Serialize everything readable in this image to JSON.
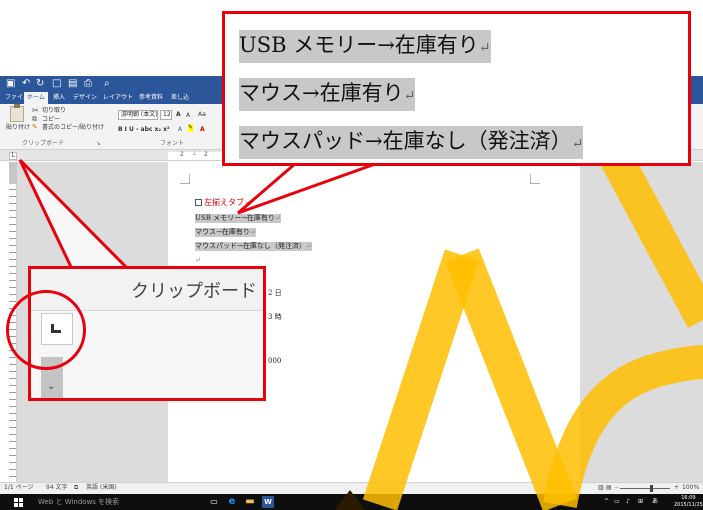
{
  "word": {
    "tabs": [
      "ファイル",
      "ホーム",
      "挿入",
      "デザイン",
      "レイアウト",
      "参考資料",
      "差し込"
    ],
    "active_tab": "ホーム",
    "clipboard": {
      "paste_label": "貼り付け",
      "cut_label": "切り取り",
      "copy_label": "コピー",
      "format_painter_label": "書式のコピー/貼り付け",
      "group_label": "クリップボード"
    },
    "font": {
      "name": "游明朝 (本文(",
      "size": "12",
      "grow": "A",
      "shrink": "A",
      "case": "Aa",
      "format_buttons": "B I U - abc x₂ x²",
      "group_label": "フォント"
    },
    "ruler_numbers": [
      "2",
      "2"
    ],
    "document": {
      "heading": "左揃えタブ",
      "lines": [
        "USB メモリー→在庫有り",
        "マウス→在庫有り",
        "マウスパッド→在庫なし（発注済）"
      ],
      "fragments": [
        "2 日",
        "3 時",
        "000"
      ]
    },
    "status": {
      "page": "1/1 ページ",
      "words": "94 文字",
      "language": "英語 (米国)",
      "zoom": "100%"
    },
    "taskbar": {
      "search_placeholder": "Web と Windows を検索",
      "time": "16:09",
      "date": "2015/11/25",
      "ime": "あ"
    }
  },
  "callout_top": {
    "lines": [
      "USB メモリー→在庫有り",
      "マウス→在庫有り",
      "マウスパッド→在庫なし（発注済）"
    ],
    "para_mark": "↵"
  },
  "callout_left": {
    "title": "クリップボード"
  },
  "colors": {
    "word_blue": "#2b579a",
    "callout_red": "#e8000b",
    "deco_yellow": "#ffbe00",
    "selection_gray": "#c8c8c8"
  }
}
